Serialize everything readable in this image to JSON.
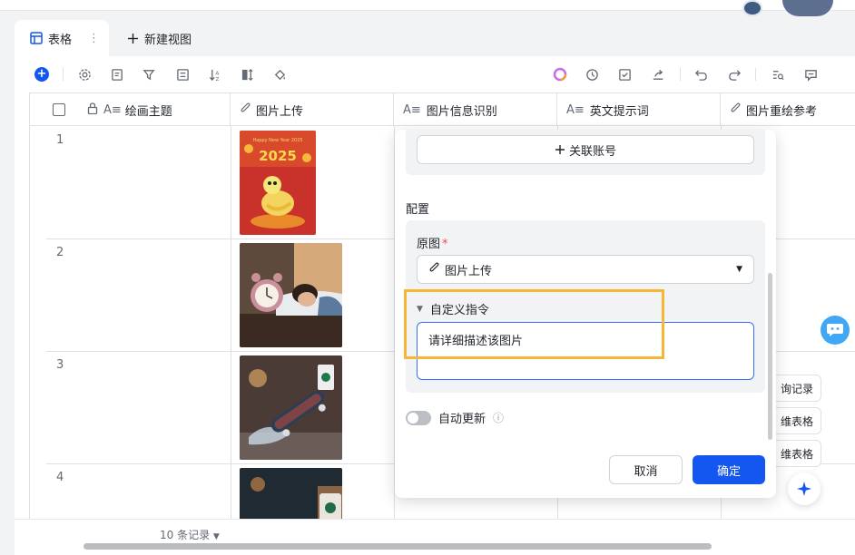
{
  "tabs": {
    "active_label": "表格",
    "more_glyph": "⋮",
    "new_view_label": "新建视图"
  },
  "toolbar": {
    "icons": [
      "add-icon",
      "settings-icon",
      "form-icon",
      "filter-icon",
      "list-icon",
      "sort-icon",
      "row-height-icon",
      "fill-color-icon",
      "ai-circle-icon",
      "history-icon",
      "checkbox-icon",
      "share-icon",
      "undo-icon",
      "redo-icon",
      "search-icon",
      "comment-icon"
    ]
  },
  "table": {
    "columns": [
      {
        "label": "绘画主题",
        "icon": "text-type-icon",
        "locked": true
      },
      {
        "label": "图片上传",
        "icon": "attachment-icon"
      },
      {
        "label": "图片信息识别",
        "icon": "text-type-icon"
      },
      {
        "label": "英文提示词",
        "icon": "text-type-icon"
      },
      {
        "label": "图片重绘参考",
        "icon": "attachment-icon"
      }
    ],
    "rows": [
      {
        "num": "1",
        "image": "snake-2025-poster",
        "image_text": "Happy New Year 2025"
      },
      {
        "num": "2",
        "image": "woman-sleeping-alarm-clock"
      },
      {
        "num": "3",
        "image": "skateboard-coffee-splash"
      },
      {
        "num": "4",
        "image": "coffee-cup"
      }
    ],
    "record_count": "10 条记录"
  },
  "side_buttons": [
    "询记录",
    "维表格",
    "维表格"
  ],
  "panel": {
    "link_account_label": "关联账号",
    "config_title": "配置",
    "source_label": "原图",
    "source_required": "*",
    "source_value": "图片上传",
    "custom_instruction_label": "自定义指令",
    "custom_instruction_value": "请详细描述该图片",
    "auto_update_label": "自动更新",
    "cancel_label": "取消",
    "confirm_label": "确定"
  },
  "colors": {
    "primary": "#1456f0",
    "highlight": "#f5b735",
    "required": "#f54a45"
  }
}
